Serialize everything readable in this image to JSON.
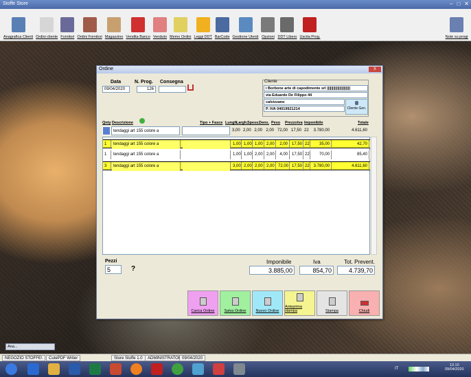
{
  "app": {
    "title": "Stoffe Store"
  },
  "toolbar": {
    "items": [
      {
        "label": "Anagrafica Clienti",
        "icon": "people-icon",
        "color": "#5a7fb5"
      },
      {
        "label": "Ordini cliente",
        "icon": "document-icon",
        "color": "#d6d6d6"
      },
      {
        "label": "Fornitori",
        "icon": "person-icon",
        "color": "#6a6a9a"
      },
      {
        "label": "Ordini Fornitori",
        "icon": "book-icon",
        "color": "#a05a4a"
      },
      {
        "label": "Magazzino",
        "icon": "box-icon",
        "color": "#c8a070"
      },
      {
        "label": "Vendita Banco",
        "icon": "sale-icon",
        "color": "#d03030"
      },
      {
        "label": "Venduto",
        "icon": "stamp-icon",
        "color": "#e08080"
      },
      {
        "label": "Memo Ordini",
        "icon": "memo-icon",
        "color": "#e0d060"
      },
      {
        "label": "Leggi DDT",
        "icon": "frame-icon",
        "color": "#f0b020"
      },
      {
        "label": "BarCode",
        "icon": "barcode-icon",
        "color": "#4a6aa0"
      },
      {
        "label": "Gestione Utenti",
        "icon": "users-icon",
        "color": "#5a8ac0"
      },
      {
        "label": "Opzioni",
        "icon": "options-icon",
        "color": "#7a7a7a"
      },
      {
        "label": "DDT Libero",
        "icon": "list-icon",
        "color": "#6a6a6a"
      },
      {
        "label": "Uscita Prog.",
        "icon": "exit-icon",
        "color": "#c02020"
      }
    ],
    "right_label": "Note su progr"
  },
  "dialog": {
    "title": "Ordine",
    "data_label": "Data",
    "data_value": "09/04/2020",
    "nprog_label": "N. Prog.",
    "nprog_value": "126",
    "consegna_label": "Consegna",
    "cliente_label": "Cliente",
    "cliente_rows": [
      "i Borbone arte di capodimonte srl ||||||||||||||||||||||",
      "via Eduardo De Filippo 44",
      "calvizzano",
      "P. IVA 04019921214"
    ],
    "cliente_gen": "Cliente Gen.",
    "headers": {
      "qnty": "Qnty",
      "descr": "Descrizione",
      "tipo": "Tipo + Fasce",
      "lungh": "Lungh.",
      "largh": "Largh.",
      "spess": "Spess.",
      "dens": "Dens.",
      "peso": "Peso",
      "prezzo": "Prezzo",
      "iva": "Iva",
      "imponibile": "Imponibile",
      "totale": "Totale"
    },
    "input_row": {
      "qnty": "",
      "descr": "tendaggi art 155 colore a",
      "tipo": "",
      "lungh": "3,00",
      "largh": "2,00",
      "spess": "2,00",
      "dens": "2,00",
      "peso": "72,00",
      "prezzo": "17,50",
      "iva": "22",
      "imponibile": "3.780,00",
      "totale": "4.611,60"
    },
    "rows": [
      {
        "qnty": "1",
        "descr": "tendaggi art 155 colore a",
        "lungh": "1,00",
        "largh": "1,00",
        "spess": "1,00",
        "dens": "2,00",
        "peso": "2,00",
        "prezzo": "17,50",
        "iva": "22",
        "imponibile": "35,00",
        "totale": "42,70",
        "hl": true
      },
      {
        "qnty": "1",
        "descr": "tendaggi art 155 colore a",
        "lungh": "1,00",
        "largh": "1,00",
        "spess": "2,00",
        "dens": "2,00",
        "peso": "4,00",
        "prezzo": "17,50",
        "iva": "22",
        "imponibile": "70,00",
        "totale": "85,40",
        "hl": false
      },
      {
        "qnty": "3",
        "descr": "tendaggi art 155 colore a",
        "lungh": "3,00",
        "largh": "2,00",
        "spess": "2,00",
        "dens": "2,00",
        "peso": "72,00",
        "prezzo": "17,50",
        "iva": "22",
        "imponibile": "3.780,00",
        "totale": "4.611,60",
        "hl": true
      }
    ],
    "pezzi_label": "Pezzi",
    "pezzi_value": "5",
    "question": "?",
    "imponibile_label": "Imponibile",
    "imponibile_value": "3.885,00",
    "iva_label": "Iva",
    "iva_value": "854,70",
    "tot_label": "Tot. Prevent.",
    "tot_value": "4.739,70",
    "buttons": [
      {
        "label": "Carica Ordine",
        "color": "#f0a0f0"
      },
      {
        "label": "Salva Ordine",
        "color": "#a0f0a0"
      },
      {
        "label": "Nuovo Ordine",
        "color": "#a0e8f8"
      },
      {
        "label": "Anteprima stampa",
        "color": "#f4f490"
      },
      {
        "label": "Stampa",
        "color": "#e4e4e4"
      },
      {
        "label": "Chiudi",
        "color": "#f8b0b0"
      }
    ]
  },
  "mini_window": {
    "label": "Ana..."
  },
  "taskstrip": [
    "NEGOZIO STOFFE\\",
    "CutePDF Writer",
    "Store Stoffe 1.0",
    "ADMINISTRATOR",
    "09/04/2020"
  ],
  "clock": {
    "time": "13.10",
    "date": "09/04/2020"
  },
  "tray": "IT"
}
